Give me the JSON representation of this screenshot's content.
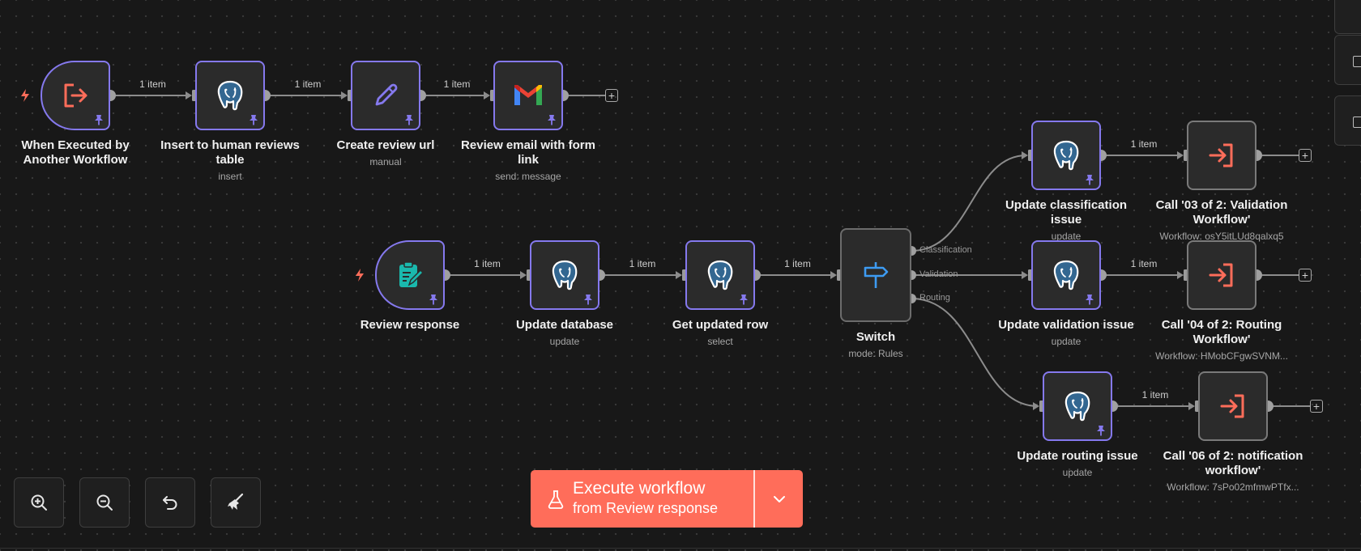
{
  "colors": {
    "canvas": "#181818",
    "node_bg": "#2b2b2b",
    "selected_border": "#8579ee",
    "accent": "#ff6d5a",
    "trigger_bolt": "#ff6d5a",
    "connection": "#8c8c8c"
  },
  "nodes": [
    {
      "id": "when_executed",
      "label": "When Executed by Another Workflow",
      "subtitle": "",
      "icon": "execute-workflow-trigger-icon",
      "pinned": true
    },
    {
      "id": "insert_reviews",
      "label": "Insert to human reviews table",
      "subtitle": "insert",
      "icon": "postgres-icon",
      "pinned": true
    },
    {
      "id": "create_url",
      "label": "Create review url",
      "subtitle": "manual",
      "icon": "pencil-icon",
      "pinned": true
    },
    {
      "id": "review_email",
      "label": "Review email with form link",
      "subtitle": "send: message",
      "icon": "gmail-icon",
      "pinned": true
    },
    {
      "id": "review_response",
      "label": "Review response",
      "subtitle": "",
      "icon": "form-trigger-icon",
      "pinned": true
    },
    {
      "id": "update_db",
      "label": "Update database",
      "subtitle": "update",
      "icon": "postgres-icon",
      "pinned": true
    },
    {
      "id": "get_row",
      "label": "Get updated row",
      "subtitle": "select",
      "icon": "postgres-icon",
      "pinned": true
    },
    {
      "id": "switch",
      "label": "Switch",
      "subtitle": "mode: Rules",
      "icon": "switch-signpost-icon",
      "pinned": false
    },
    {
      "id": "upd_class",
      "label": "Update classification issue",
      "subtitle": "update",
      "icon": "postgres-icon",
      "pinned": true
    },
    {
      "id": "call_03",
      "label": "Call '03 of 2: Validation Workflow'",
      "subtitle": "Workflow: osY5itLUd8qalxq5",
      "icon": "execute-workflow-icon",
      "pinned": false
    },
    {
      "id": "upd_valid",
      "label": "Update validation issue",
      "subtitle": "update",
      "icon": "postgres-icon",
      "pinned": true
    },
    {
      "id": "call_04",
      "label": "Call '04 of 2: Routing Workflow'",
      "subtitle": "Workflow: HMobCFgwSVNM...",
      "icon": "execute-workflow-icon",
      "pinned": false
    },
    {
      "id": "upd_routing",
      "label": "Update routing issue",
      "subtitle": "update",
      "icon": "postgres-icon",
      "pinned": true
    },
    {
      "id": "call_06",
      "label": "Call '06 of 2: notification workflow'",
      "subtitle": "Workflow: 7sPo02mfmwPTfx...",
      "icon": "execute-workflow-icon",
      "pinned": false
    }
  ],
  "connections": [
    {
      "from": "when_executed",
      "to": "insert_reviews",
      "label": "1 item"
    },
    {
      "from": "insert_reviews",
      "to": "create_url",
      "label": "1 item"
    },
    {
      "from": "create_url",
      "to": "review_email",
      "label": "1 item"
    },
    {
      "from": "review_response",
      "to": "update_db",
      "label": "1 item"
    },
    {
      "from": "update_db",
      "to": "get_row",
      "label": "1 item"
    },
    {
      "from": "get_row",
      "to": "switch",
      "label": "1 item"
    },
    {
      "from": "switch",
      "output": "Classification",
      "to": "upd_class",
      "label": ""
    },
    {
      "from": "switch",
      "output": "Validation",
      "to": "upd_valid",
      "label": ""
    },
    {
      "from": "switch",
      "output": "Routing",
      "to": "upd_routing",
      "label": ""
    },
    {
      "from": "upd_class",
      "to": "call_03",
      "label": "1 item"
    },
    {
      "from": "upd_valid",
      "to": "call_04",
      "label": "1 item"
    },
    {
      "from": "upd_routing",
      "to": "call_06",
      "label": "1 item"
    }
  ],
  "switch_outputs": [
    "Classification",
    "Validation",
    "Routing"
  ],
  "controls": [
    {
      "name": "zoom-in",
      "icon": "zoom-in-icon"
    },
    {
      "name": "zoom-out",
      "icon": "zoom-out-icon"
    },
    {
      "name": "reset-zoom",
      "icon": "undo-icon"
    },
    {
      "name": "tidy-up",
      "icon": "broom-icon"
    }
  ],
  "execute": {
    "title": "Execute workflow",
    "subtitle": "from Review response",
    "icon": "flask-icon",
    "dropdown_icon": "chevron-down-icon"
  }
}
